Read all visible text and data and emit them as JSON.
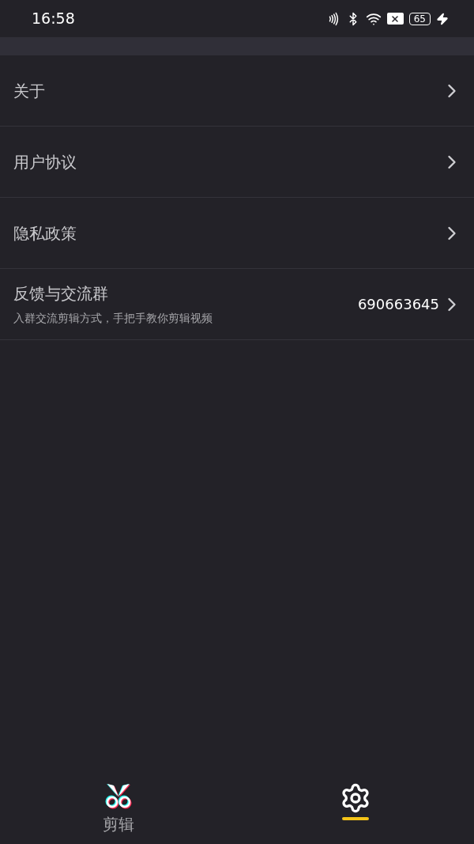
{
  "status_bar": {
    "time": "16:58",
    "battery": "65"
  },
  "menu": [
    {
      "title": "关于"
    },
    {
      "title": "用户协议"
    },
    {
      "title": "隐私政策"
    },
    {
      "title": "反馈与交流群",
      "subtitle": "入群交流剪辑方式，手把手教你剪辑视频",
      "value": "690663645"
    }
  ],
  "tabs": [
    {
      "kind": "scissors",
      "label": "剪辑",
      "selected": false
    },
    {
      "kind": "gear",
      "selected": true
    }
  ]
}
